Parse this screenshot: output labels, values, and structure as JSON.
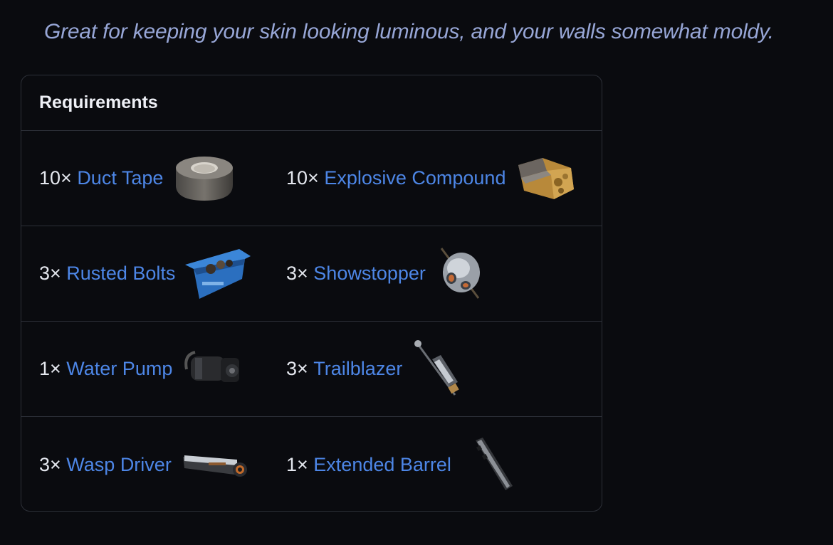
{
  "tagline": "Great for keeping your skin looking luminous, and your walls somewhat moldy.",
  "requirements": {
    "title": "Requirements",
    "items": [
      {
        "qty": "10×",
        "name": "Duct Tape",
        "icon": "duct-tape-icon"
      },
      {
        "qty": "10×",
        "name": "Explosive Compound",
        "icon": "explosive-compound-icon"
      },
      {
        "qty": "3×",
        "name": "Rusted Bolts",
        "icon": "rusted-bolts-icon"
      },
      {
        "qty": "3×",
        "name": "Showstopper",
        "icon": "showstopper-icon"
      },
      {
        "qty": "1×",
        "name": "Water Pump",
        "icon": "water-pump-icon"
      },
      {
        "qty": "3×",
        "name": "Trailblazer",
        "icon": "trailblazer-icon"
      },
      {
        "qty": "3×",
        "name": "Wasp Driver",
        "icon": "wasp-driver-icon"
      },
      {
        "qty": "1×",
        "name": "Extended Barrel",
        "icon": "extended-barrel-icon"
      }
    ]
  }
}
